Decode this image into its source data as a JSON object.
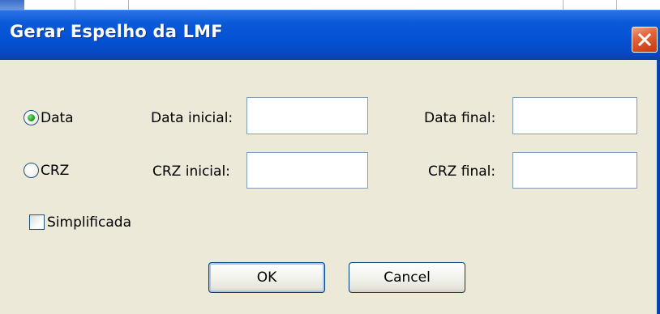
{
  "window": {
    "title": "Gerar Espelho da LMF",
    "close_icon": "close-icon",
    "close_color": "#d2481f",
    "titlebar_color": "#0551d4",
    "client_background": "#ece9d8"
  },
  "mode": {
    "selected": "Data",
    "options": [
      {
        "label": "Data",
        "selected": true
      },
      {
        "label": "CRZ",
        "selected": false
      }
    ]
  },
  "date_row": {
    "initial_label": "Data inicial:",
    "initial_value": "",
    "final_label": "Data final:",
    "final_value": ""
  },
  "crz_row": {
    "initial_label": "CRZ inicial:",
    "initial_value": "",
    "final_label": "CRZ final:",
    "final_value": ""
  },
  "simplificada": {
    "label": "Simplificada",
    "checked": false
  },
  "buttons": {
    "ok": "OK",
    "cancel": "Cancel"
  }
}
